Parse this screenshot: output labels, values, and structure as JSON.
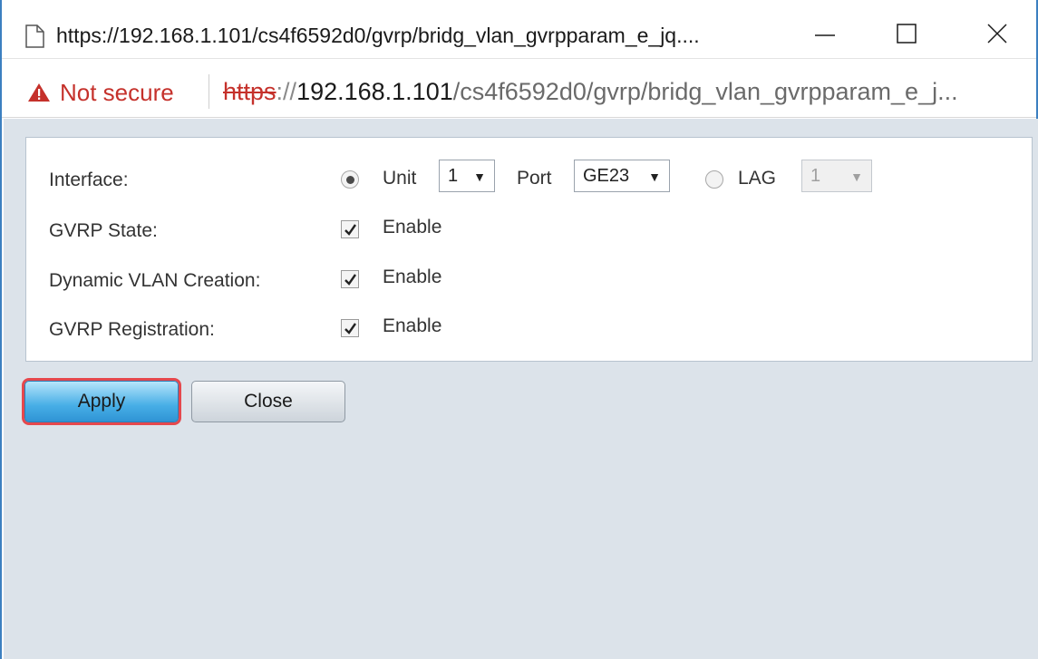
{
  "window": {
    "title": "https://192.168.1.101/cs4f6592d0/gvrp/bridg_vlan_gvrpparam_e_jq....",
    "controls": {
      "minimize": "minimize",
      "maximize": "maximize",
      "close": "close"
    }
  },
  "address_bar": {
    "security_label": "Not secure",
    "url_scheme": "https",
    "url_separator": "://",
    "url_host": "192.168.1.101",
    "url_path": "/cs4f6592d0/gvrp/bridg_vlan_gvrpparam_e_j..."
  },
  "form": {
    "interface": {
      "label": "Interface:",
      "unit_label": "Unit",
      "unit_value": "1",
      "port_label": "Port",
      "port_value": "GE23",
      "lag_label": "LAG",
      "lag_value": "1",
      "selected": "unit"
    },
    "gvrp_state": {
      "label": "GVRP State:",
      "option": "Enable",
      "checked": true
    },
    "dynamic_vlan_creation": {
      "label": "Dynamic VLAN Creation:",
      "option": "Enable",
      "checked": true
    },
    "gvrp_registration": {
      "label": "GVRP Registration:",
      "option": "Enable",
      "checked": true
    }
  },
  "buttons": {
    "apply": "Apply",
    "close": "Close"
  },
  "colors": {
    "accent": "#3c7fc0",
    "warning": "#c5312b",
    "highlight": "#e5484d"
  }
}
